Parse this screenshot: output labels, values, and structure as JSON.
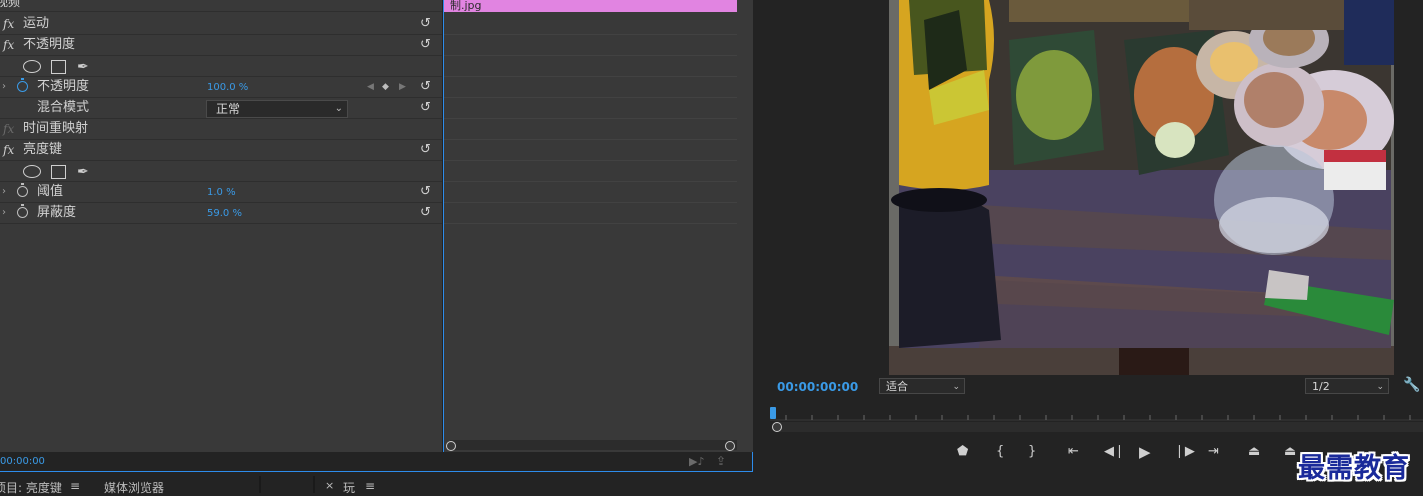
{
  "effect_controls": {
    "header_label": "视频",
    "effects": [
      {
        "name": "运动",
        "has_fx": true,
        "fx_active": true
      },
      {
        "name": "不透明度",
        "has_fx": true,
        "fx_active": true
      },
      {
        "name": "时间重映射",
        "has_fx": true,
        "fx_active": false
      },
      {
        "name": "亮度键",
        "has_fx": true,
        "fx_active": true
      }
    ],
    "params": {
      "opacity": {
        "label": "不透明度",
        "value": "100.0 %"
      },
      "blend_mode": {
        "label": "混合模式",
        "value": "正常"
      },
      "threshold": {
        "label": "阈值",
        "value": "1.0 %"
      },
      "cutoff": {
        "label": "屏蔽度",
        "value": "59.0 %"
      }
    },
    "clip_name": "制.jpg",
    "timecode": "00:00:00",
    "fx_symbol": "fx",
    "reset_symbol": "↺"
  },
  "program_monitor": {
    "timecode": "00:00:00:00",
    "fit_option": "适合",
    "resolution": "1/2"
  },
  "bottom_tabs": {
    "project_tab": "项目: 亮度键",
    "menu_glyph": "≡",
    "media_browser": "媒体浏览器",
    "close_glyph": "×",
    "sequence_tab": "玩"
  },
  "watermark": "最需教育",
  "colors": {
    "accent": "#2d8ceb",
    "value_blue": "#3a9ae6",
    "clip_pink": "#e184e1",
    "panel_bg": "#393939"
  }
}
